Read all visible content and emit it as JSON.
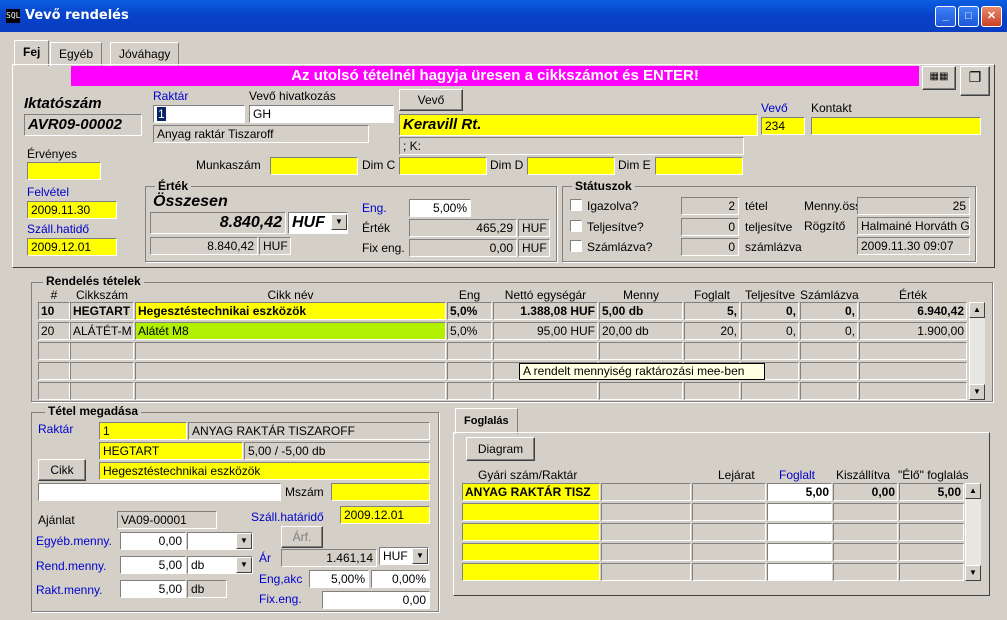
{
  "window": {
    "title": "Vevő rendelés",
    "icon": "app-icon"
  },
  "tabs": [
    "Fej",
    "Egyéb",
    "Jóváhagy"
  ],
  "banner": "Az utolsó tételnél hagyja üresen a cikkszámot és ENTER!",
  "header": {
    "iktatoszam_label": "Iktatószám",
    "iktatoszam": "AVR09-00002",
    "raktar_label": "Raktár",
    "raktar_code": "1",
    "raktar_name": "Anyag raktár Tiszaroff",
    "vevo_hiv_label": "Vevő hivatkozás",
    "vevo_hiv": "GH",
    "vevo_button": "Vevő",
    "vevo_name": "Keravill Rt.",
    "vevo_label": "Vevő",
    "vevo_code": "234",
    "kontakt_label": "Kontakt",
    "kontakt": "",
    "address": "; K:",
    "ervenyes_label": "Érvényes",
    "ervenyes": "",
    "felvetel_label": "Felvétel",
    "felvetel": "2009.11.30",
    "szall_label": "Száll.hatidő",
    "szall": "2009.12.01",
    "munkaszam_label": "Munkaszám",
    "munkaszam": "",
    "dimc_label": "Dim C",
    "dimc": "",
    "dimd_label": "Dim D",
    "dimd": "",
    "dime_label": "Dim E",
    "dime": ""
  },
  "ertek": {
    "title": "Érték",
    "osszesen_label": "Összesen",
    "osszesen": "8.840,42",
    "currency": "HUF",
    "osszesen2": "8.840,42",
    "currency2": "HUF",
    "eng_label": "Eng.",
    "eng": "5,00%",
    "ertek_label": "Érték",
    "ertek": "465,29",
    "ertek_cur": "HUF",
    "fix_label": "Fix eng.",
    "fix": "0,00",
    "fix_cur": "HUF"
  },
  "statusz": {
    "title": "Státuszok",
    "igazolva": "Igazolva?",
    "teljesitve": "Teljesítve?",
    "szamlazva": "Számlázva?",
    "tetel_val": "2",
    "tetel_label": "tétel",
    "telj_val": "0",
    "telj_label": "teljesítve",
    "szaml_val": "0",
    "szaml_label": "számlázva",
    "menny_label": "Menny.össz",
    "menny": "25",
    "rogzito_label": "Rögzítő",
    "rogzito": "Halmainé Horváth G",
    "date": "2009.11.30 09:07"
  },
  "items": {
    "title": "Rendelés tételek",
    "columns": [
      "#",
      "Cikkszám",
      "Cikk név",
      "Eng",
      "Nettó egységár",
      "Menny",
      "Foglalt",
      "Teljesítve",
      "Számlázva",
      "Érték"
    ],
    "rows": [
      [
        "10",
        "HEGTART",
        "Hegesztéstechnikai eszközök",
        "5,0%",
        "1.388,08 HUF",
        "5,00 db",
        "5,",
        "0,",
        "0,",
        "6.940,42"
      ],
      [
        "20",
        "ALÁTÉT-M",
        "Alátét M8",
        "5,0%",
        "95,00 HUF",
        "20,00 db",
        "20,",
        "0,",
        "0,",
        "1.900,00"
      ]
    ],
    "tooltip": "A rendelt mennyiség raktározási mee-ben"
  },
  "tetel": {
    "title": "Tétel megadása",
    "raktar_label": "Raktár",
    "raktar_code": "1",
    "raktar_name": "ANYAG RAKTÁR TISZAROFF",
    "cikk_code": "HEGTART",
    "stock": "5,00 / -5,00 db",
    "cikk_button": "Cikk",
    "cikk_name": "Hegesztéstechnikai eszközök",
    "mszam_label": "Mszám",
    "mszam": "",
    "ajanlat_label": "Ajánlat",
    "ajanlat": "VA09-00001",
    "szall_label": "Száll.határidő",
    "szall": "2009.12.01",
    "arf_button": "Árf.",
    "egyeb_label": "Egyéb.menny.",
    "egyeb": "0,00",
    "rend_label": "Rend.menny.",
    "rend": "5,00",
    "rend_unit": "db",
    "rakt_label": "Rakt.menny.",
    "rakt": "5,00",
    "rakt_unit": "db",
    "ar_label": "Ár",
    "ar": "1.461,14",
    "ar_cur": "HUF",
    "engakc_label": "Eng,akc",
    "eng": "5,00%",
    "akc": "0,00%",
    "fixeng_label": "Fix.eng.",
    "fixeng": "0,00"
  },
  "foglalas": {
    "tab": "Foglalás",
    "diagram_button": "Diagram",
    "columns": [
      "Gyári szám/Raktár",
      "Lejárat",
      "Foglalt",
      "Kiszállítva",
      "\"Élő\" foglalás"
    ],
    "row": [
      "ANYAG RAKTÁR TISZ",
      "",
      "",
      "5,00",
      "0,00",
      "5,00"
    ]
  },
  "colors": {
    "banner": "#ff00ff",
    "highlight": "#ffff00",
    "green": "#b0f000"
  }
}
